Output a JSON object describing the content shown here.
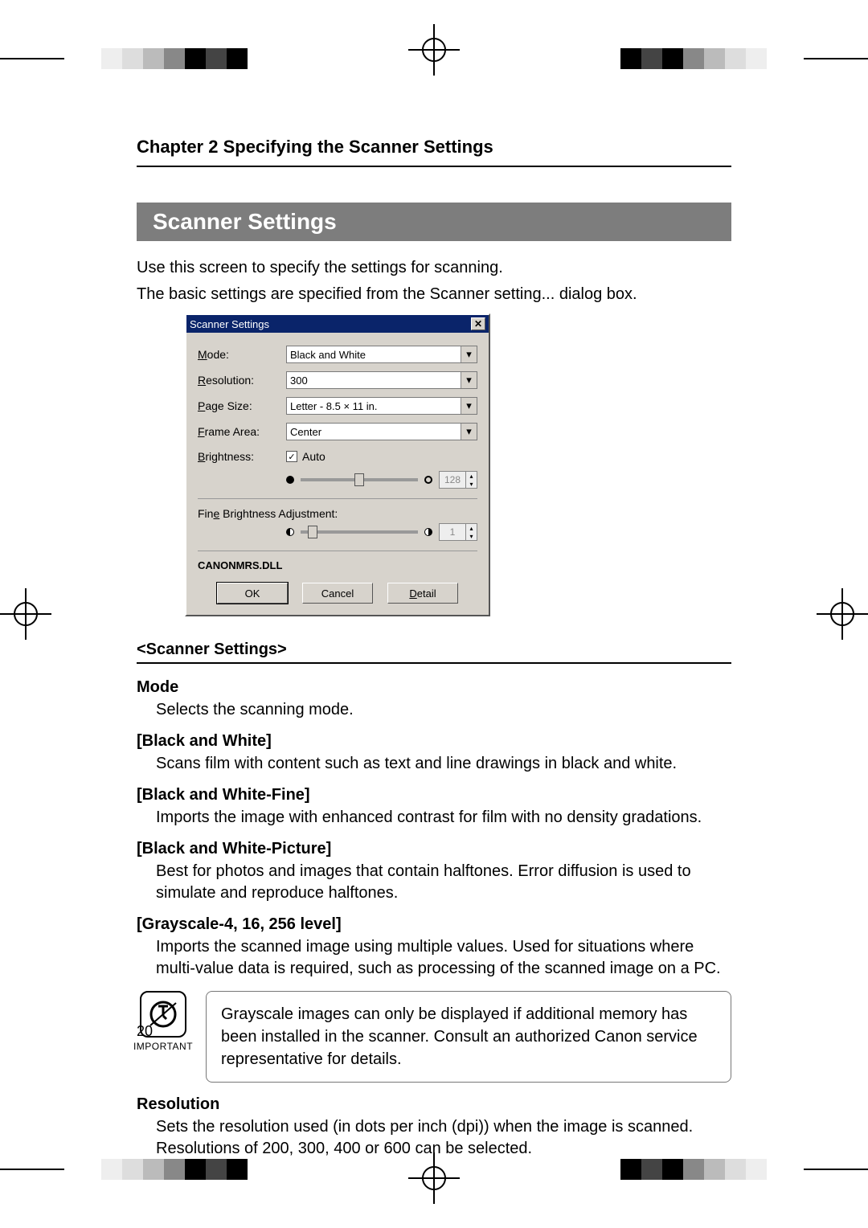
{
  "chapter_title": "Chapter 2 Specifying the Scanner Settings",
  "section_banner": "Scanner Settings",
  "intro_line1": "Use this screen to specify the settings for scanning.",
  "intro_line2": "The basic settings are specified from the Scanner setting... dialog box.",
  "dialog": {
    "title": "Scanner Settings",
    "mode_label": "Mode:",
    "mode_value": "Black and White",
    "resolution_label": "Resolution:",
    "resolution_value": "300",
    "pagesize_label": "Page Size:",
    "pagesize_value": "Letter - 8.5 × 11 in.",
    "framearea_label": "Frame Area:",
    "framearea_value": "Center",
    "brightness_label": "Brightness:",
    "auto_label": "Auto",
    "brightness_value": "128",
    "fine_label": "Fine Brightness Adjustment:",
    "fine_value": "1",
    "dll": "CANONMRS.DLL",
    "btn_ok": "OK",
    "btn_cancel": "Cancel",
    "btn_detail": "Detail"
  },
  "settings_hdr": "<Scanner Settings>",
  "mode": {
    "title": "Mode",
    "desc": "Selects the scanning mode."
  },
  "bw": {
    "title": "[Black and White]",
    "desc": "Scans film with content such as text and line drawings in black and white."
  },
  "bwfine": {
    "title": "[Black and White-Fine]",
    "desc": "Imports the image with enhanced contrast for film with no density gradations."
  },
  "bwpic": {
    "title": "[Black and White-Picture]",
    "desc": "Best for photos and images that contain halftones. Error diffusion is used to simulate and reproduce halftones."
  },
  "gray": {
    "title": "[Grayscale-4, 16, 256 level]",
    "desc": "Imports the scanned image using multiple values. Used for situations where multi-value data is required, such as processing of the scanned image on a PC."
  },
  "callout": {
    "label": "IMPORTANT",
    "text": "Grayscale images can only be displayed if additional memory has been installed in the scanner. Consult an authorized Canon service representative for details."
  },
  "resolution": {
    "title": "Resolution",
    "desc": "Sets the resolution used (in dots per inch (dpi)) when the image is scanned. Resolutions of 200, 300, 400 or 600 can be selected."
  },
  "page_number": "20"
}
